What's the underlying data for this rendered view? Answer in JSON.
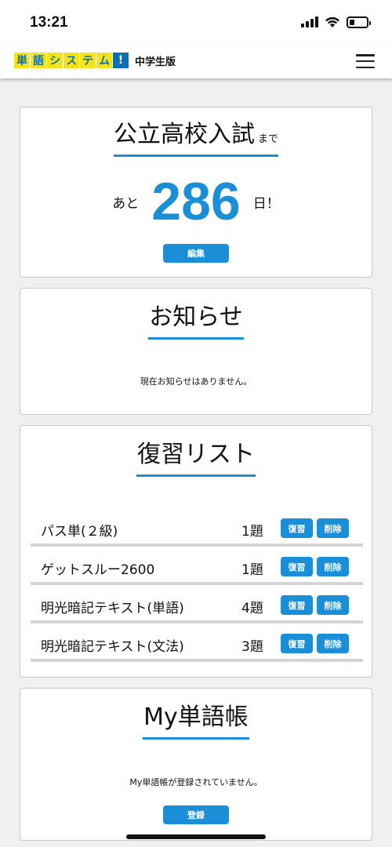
{
  "status_bar": {
    "time": "13:21"
  },
  "header": {
    "logo_chars": [
      "単",
      "語",
      "シ",
      "ス",
      "テ",
      "ム",
      "!"
    ],
    "logo_sub": "中学生版"
  },
  "countdown": {
    "title": "公立高校入試",
    "title_suffix": "まで",
    "prefix": "あと",
    "days": "286",
    "suffix": "日！",
    "edit_label": "編集"
  },
  "notices": {
    "title": "お知らせ",
    "empty_text": "現在お知らせはありません。"
  },
  "review": {
    "title": "復習リスト",
    "review_label": "復習",
    "delete_label": "削除",
    "items": [
      {
        "name": "パス単(２級)",
        "count": "1題"
      },
      {
        "name": "ゲットスルー2600",
        "count": "1題"
      },
      {
        "name": "明光暗記テキスト(単語)",
        "count": "4題"
      },
      {
        "name": "明光暗記テキスト(文法)",
        "count": "3題"
      }
    ]
  },
  "mywords": {
    "title": "My単語帳",
    "empty_text": "My単語帳が登録されていません。",
    "register_label": "登録"
  },
  "colors": {
    "accent": "#1a8fd8",
    "logo_yellow": "#f7e418",
    "logo_blue": "#0a6fb5"
  }
}
